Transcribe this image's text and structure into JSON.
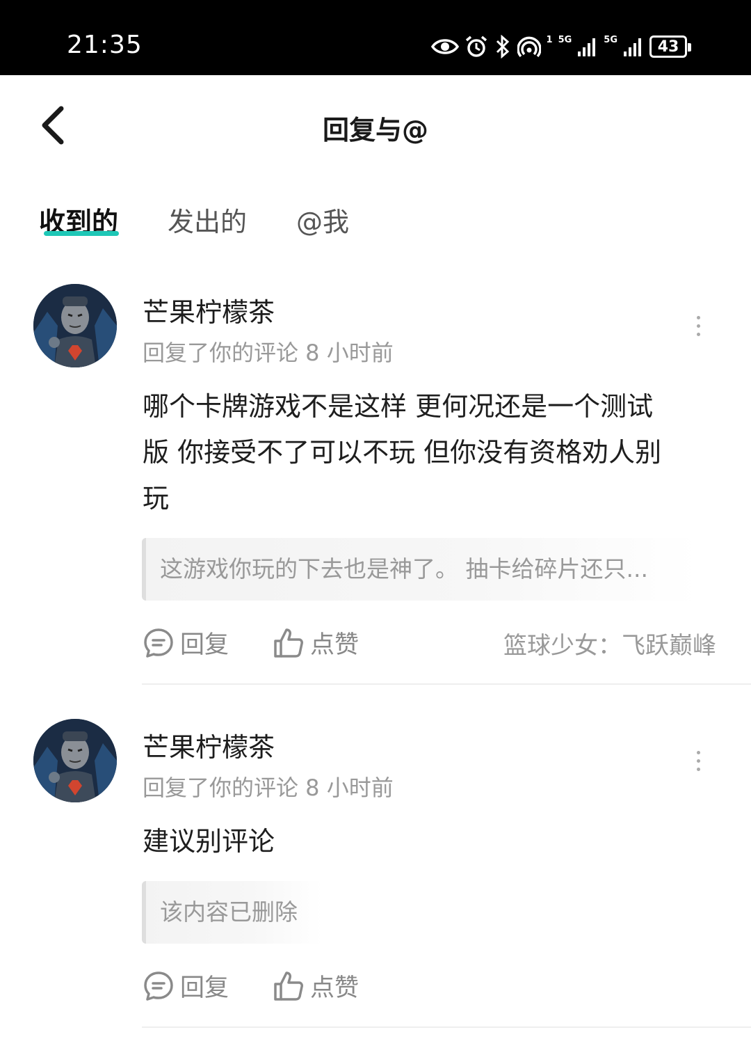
{
  "status_bar": {
    "time": "21:35",
    "battery": "43",
    "network_1": "5G",
    "network_2": "5G",
    "sim_index": "1",
    "icons": [
      "eye-icon",
      "alarm-icon",
      "bluetooth-icon",
      "hotspot-icon",
      "signal-icon",
      "signal-icon",
      "battery-icon"
    ]
  },
  "nav": {
    "title": "回复与@",
    "back_icon": "chevron-left-icon"
  },
  "tabs": [
    {
      "label": "收到的",
      "active": true
    },
    {
      "label": "发出的",
      "active": false
    },
    {
      "label": "@我",
      "active": false
    }
  ],
  "accent_color": "#1ec7b6",
  "items": [
    {
      "username": "芒果柠檬茶",
      "meta": "回复了你的评论 8 小时前",
      "content_lines": [
        "哪个卡牌游戏不是这样 更何况还是一个测试",
        "版 你接受不了可以不玩 但你没有资格劝人别",
        "玩"
      ],
      "quote": "这游戏你玩的下去也是神了。 抽卡给碎片还只...",
      "reply_label": "回复",
      "like_label": "点赞",
      "source": "篮球少女：飞跃巅峰"
    },
    {
      "username": "芒果柠檬茶",
      "meta": "回复了你的评论 8 小时前",
      "content_lines": [
        "建议别评论"
      ],
      "quote": "该内容已删除",
      "reply_label": "回复",
      "like_label": "点赞",
      "source": ""
    }
  ]
}
